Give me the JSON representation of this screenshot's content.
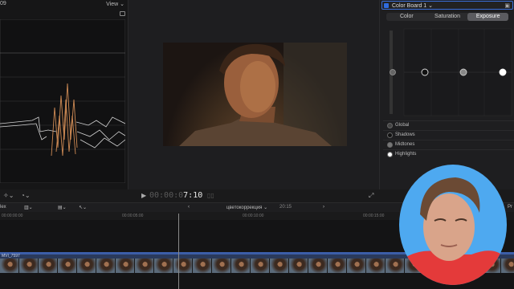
{
  "scopes": {
    "number_label": "09",
    "view_menu": "View ⌄"
  },
  "viewer": {
    "image_desc": "video frame"
  },
  "inspector": {
    "color_board_title": "Color Board 1 ⌄",
    "tabs": [
      {
        "label": "Color",
        "active": false
      },
      {
        "label": "Saturation",
        "active": false
      },
      {
        "label": "Exposure",
        "active": true
      }
    ],
    "rows": [
      "Global",
      "Shadows",
      "Midtones",
      "Highlights"
    ]
  },
  "toolbar": {
    "timecode_dim": "00:00:0",
    "timecode_bright": "7:10"
  },
  "timeline": {
    "left_label": "lex",
    "project_name": "цветокоррекция ⌄",
    "duration": "20:15",
    "ruler": [
      "00:00:00:00",
      "00:00:05:00",
      "00:00:10:00",
      "00:00:15:00"
    ],
    "clip_name": "MVI_7597",
    "right_label": "Pr"
  },
  "colors": {
    "accent": "#2f6bdf",
    "clip": "#3c5ea8"
  }
}
